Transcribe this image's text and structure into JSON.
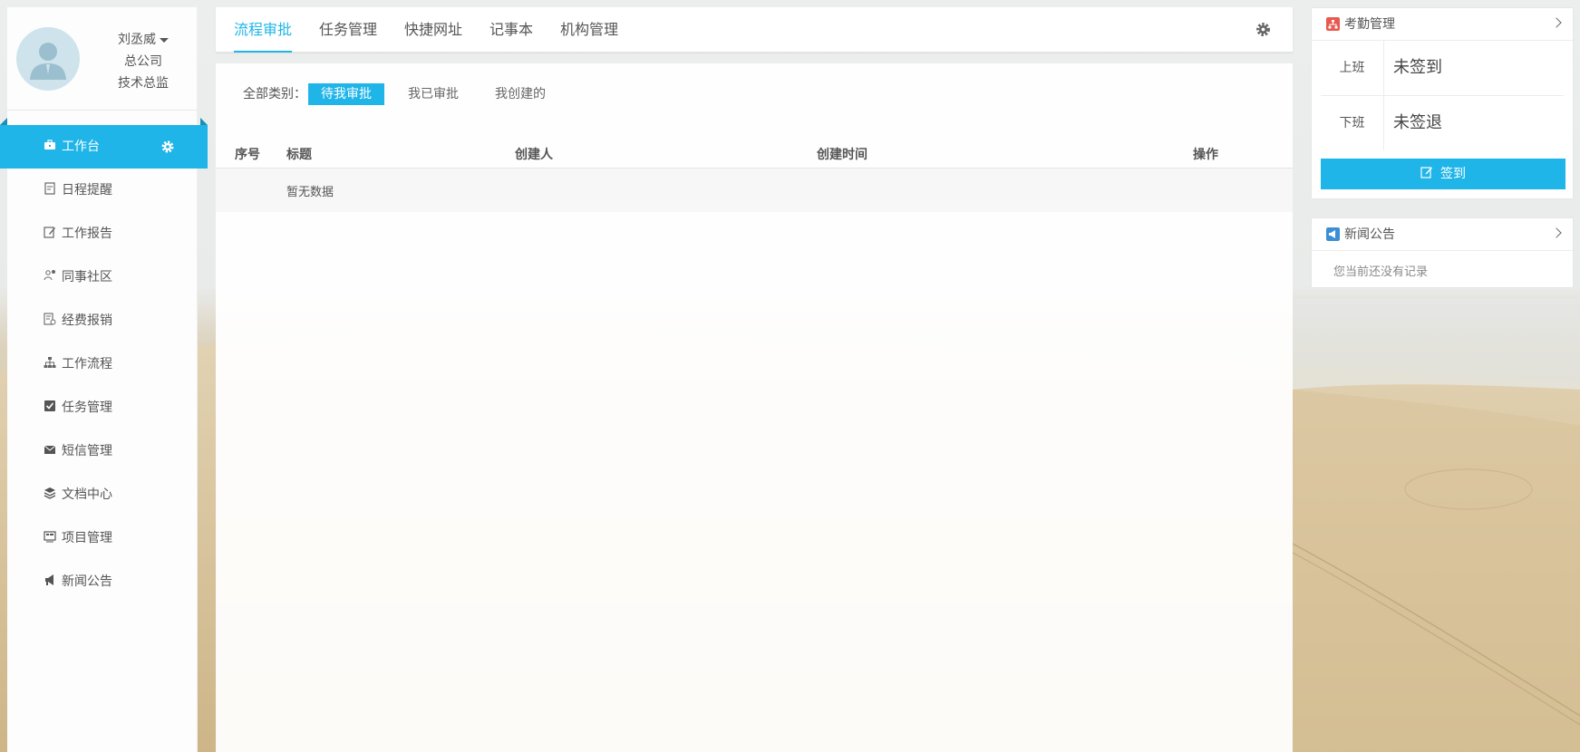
{
  "user": {
    "name": "刘丞威",
    "company": "总公司",
    "title": "技术总监"
  },
  "menu": {
    "items": [
      {
        "label": "工作台",
        "icon": "briefcase-icon"
      },
      {
        "label": "日程提醒",
        "icon": "calendar-note-icon"
      },
      {
        "label": "工作报告",
        "icon": "report-edit-icon"
      },
      {
        "label": "同事社区",
        "icon": "people-icon"
      },
      {
        "label": "经费报销",
        "icon": "expense-icon"
      },
      {
        "label": "工作流程",
        "icon": "sitemap-icon"
      },
      {
        "label": "任务管理",
        "icon": "checkbox-icon"
      },
      {
        "label": "短信管理",
        "icon": "envelope-icon"
      },
      {
        "label": "文档中心",
        "icon": "layers-icon"
      },
      {
        "label": "项目管理",
        "icon": "project-icon"
      },
      {
        "label": "新闻公告",
        "icon": "bullhorn-icon"
      }
    ]
  },
  "tabs": [
    {
      "label": "流程审批"
    },
    {
      "label": "任务管理"
    },
    {
      "label": "快捷网址"
    },
    {
      "label": "记事本"
    },
    {
      "label": "机构管理"
    }
  ],
  "filter": {
    "label": "全部类别：",
    "options": [
      {
        "label": "待我审批"
      },
      {
        "label": "我已审批"
      },
      {
        "label": "我创建的"
      }
    ]
  },
  "table": {
    "headers": [
      "序号",
      "标题",
      "创建人",
      "创建时间",
      "操作"
    ],
    "empty_text": "暂无数据"
  },
  "attendance": {
    "title": "考勤管理",
    "rows": [
      {
        "key": "上班",
        "value": "未签到"
      },
      {
        "key": "下班",
        "value": "未签退"
      }
    ],
    "button": "签到"
  },
  "news": {
    "title": "新闻公告",
    "empty_text": "您当前还没有记录"
  },
  "colors": {
    "accent": "#1fb5e8",
    "attendance_icon": "#e85a4f",
    "news_icon": "#3a8fd6"
  }
}
